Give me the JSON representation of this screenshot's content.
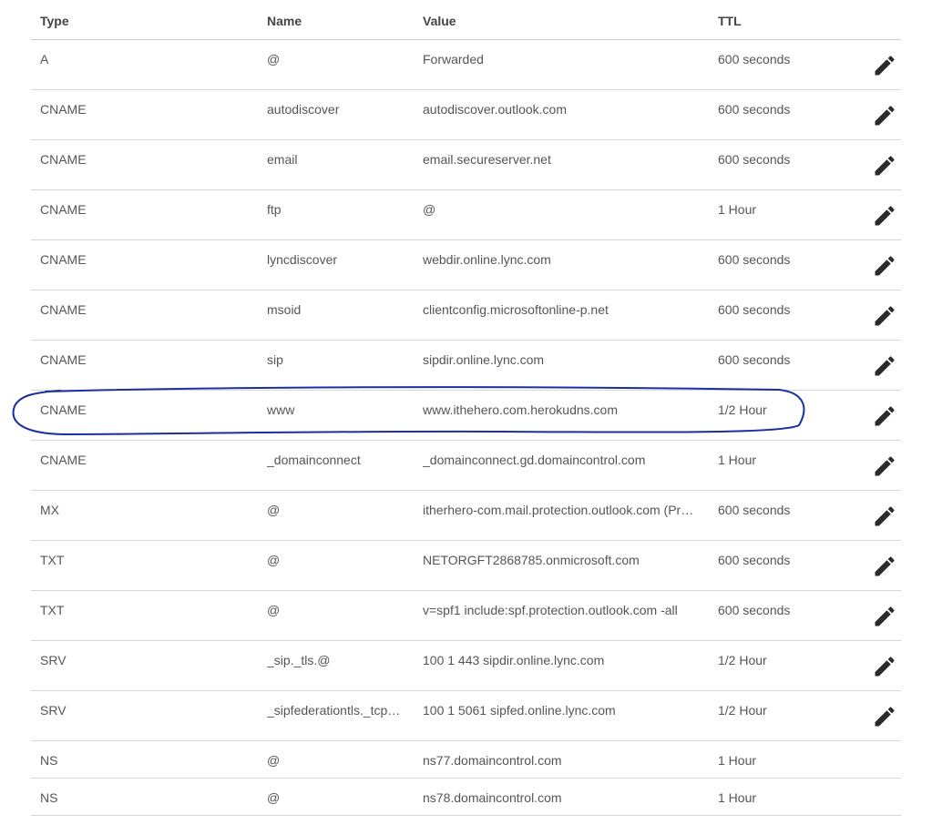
{
  "table": {
    "headers": {
      "type": "Type",
      "name": "Name",
      "value": "Value",
      "ttl": "TTL"
    },
    "rows": [
      {
        "type": "A",
        "name": "@",
        "value": "Forwarded",
        "ttl": "600 seconds",
        "editable": true
      },
      {
        "type": "CNAME",
        "name": "autodiscover",
        "value": "autodiscover.outlook.com",
        "ttl": "600 seconds",
        "editable": true
      },
      {
        "type": "CNAME",
        "name": "email",
        "value": "email.secureserver.net",
        "ttl": "600 seconds",
        "editable": true
      },
      {
        "type": "CNAME",
        "name": "ftp",
        "value": "@",
        "ttl": "1 Hour",
        "editable": true
      },
      {
        "type": "CNAME",
        "name": "lyncdiscover",
        "value": "webdir.online.lync.com",
        "ttl": "600 seconds",
        "editable": true
      },
      {
        "type": "CNAME",
        "name": "msoid",
        "value": "clientconfig.microsoftonline-p.net",
        "ttl": "600 seconds",
        "editable": true
      },
      {
        "type": "CNAME",
        "name": "sip",
        "value": "sipdir.online.lync.com",
        "ttl": "600 seconds",
        "editable": true
      },
      {
        "type": "CNAME",
        "name": "www",
        "value": "www.ithehero.com.herokudns.com",
        "ttl": "1/2 Hour",
        "editable": true,
        "highlighted": true
      },
      {
        "type": "CNAME",
        "name": "_domainconnect",
        "value": "_domainconnect.gd.domaincontrol.com",
        "ttl": "1 Hour",
        "editable": true
      },
      {
        "type": "MX",
        "name": "@",
        "value": "itherhero-com.mail.protection.outlook.com (Pr…",
        "ttl": "600 seconds",
        "editable": true
      },
      {
        "type": "TXT",
        "name": "@",
        "value": "NETORGFT2868785.onmicrosoft.com",
        "ttl": "600 seconds",
        "editable": true
      },
      {
        "type": "TXT",
        "name": "@",
        "value": "v=spf1 include:spf.protection.outlook.com -all",
        "ttl": "600 seconds",
        "editable": true
      },
      {
        "type": "SRV",
        "name": "_sip._tls.@",
        "value": "100 1 443 sipdir.online.lync.com",
        "ttl": "1/2 Hour",
        "editable": true
      },
      {
        "type": "SRV",
        "name": "_sipfederationtls._tcp…",
        "value": "100 1 5061 sipfed.online.lync.com",
        "ttl": "1/2 Hour",
        "editable": true
      },
      {
        "type": "NS",
        "name": "@",
        "value": "ns77.domaincontrol.com",
        "ttl": "1 Hour",
        "editable": false
      },
      {
        "type": "NS",
        "name": "@",
        "value": "ns78.domaincontrol.com",
        "ttl": "1 Hour",
        "editable": false
      }
    ]
  },
  "icons": {
    "edit": "pencil-icon"
  },
  "colors": {
    "highlight_ink": "#1a2fa0",
    "text": "#555555",
    "icon": "#2b2b2b"
  }
}
